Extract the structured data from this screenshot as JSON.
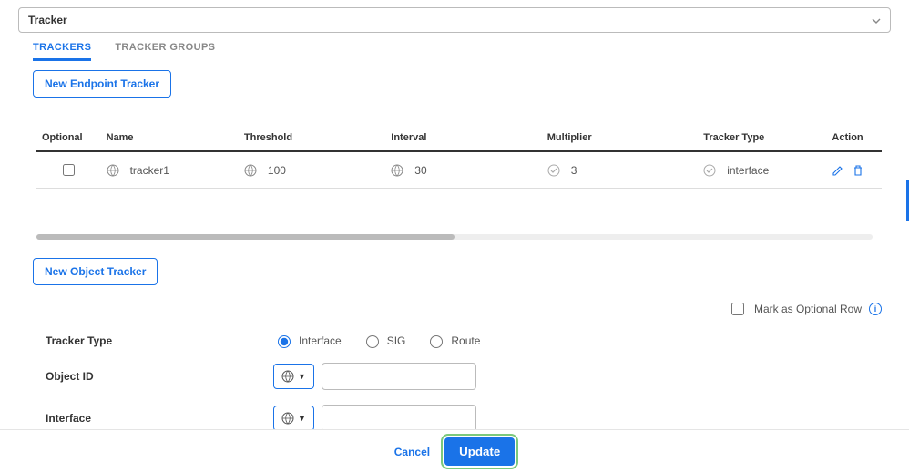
{
  "dropdown": {
    "selected": "Tracker"
  },
  "tabs": {
    "trackers": "TRACKERS",
    "groups": "TRACKER GROUPS"
  },
  "buttons": {
    "new_endpoint": "New Endpoint Tracker",
    "new_object": "New Object Tracker",
    "cancel": "Cancel",
    "update": "Update"
  },
  "table": {
    "headers": {
      "optional": "Optional",
      "name": "Name",
      "threshold": "Threshold",
      "interval": "Interval",
      "multiplier": "Multiplier",
      "tracker_type": "Tracker Type",
      "action": "Action"
    },
    "row": {
      "name": "tracker1",
      "threshold": "100",
      "interval": "30",
      "multiplier": "3",
      "tracker_type": "interface"
    }
  },
  "optional_row_label": "Mark as Optional Row",
  "form": {
    "tracker_type_label": "Tracker Type",
    "object_id_label": "Object ID",
    "interface_label": "Interface",
    "radios": {
      "interface": "Interface",
      "sig": "SIG",
      "route": "Route"
    }
  }
}
